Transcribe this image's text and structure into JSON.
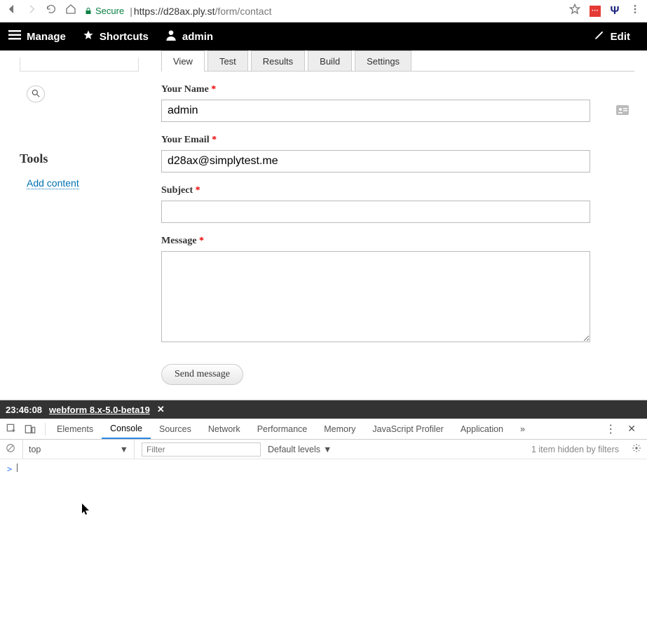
{
  "chrome": {
    "secure_label": "Secure",
    "url_host": "https://d28ax.ply.st",
    "url_path": "/form/contact"
  },
  "adminbar": {
    "manage": "Manage",
    "shortcuts": "Shortcuts",
    "user": "admin",
    "edit": "Edit"
  },
  "sidebar": {
    "tools_heading": "Tools",
    "add_content": "Add content"
  },
  "tabs": [
    "View",
    "Test",
    "Results",
    "Build",
    "Settings"
  ],
  "form": {
    "name_label": "Your Name",
    "name_value": "admin",
    "email_label": "Your Email",
    "email_value": "d28ax@simplytest.me",
    "subject_label": "Subject",
    "subject_value": "",
    "message_label": "Message",
    "message_value": "",
    "submit_label": "Send message"
  },
  "devtools": {
    "time": "23:46:08",
    "title": "webform 8.x-5.0-beta19",
    "tabs": [
      "Elements",
      "Console",
      "Sources",
      "Network",
      "Performance",
      "Memory",
      "JavaScript Profiler",
      "Application"
    ],
    "active_tab": "Console",
    "context": "top",
    "filter_placeholder": "Filter",
    "levels_label": "Default levels",
    "hidden_note": "1 item hidden by filters",
    "prompt": ">"
  }
}
